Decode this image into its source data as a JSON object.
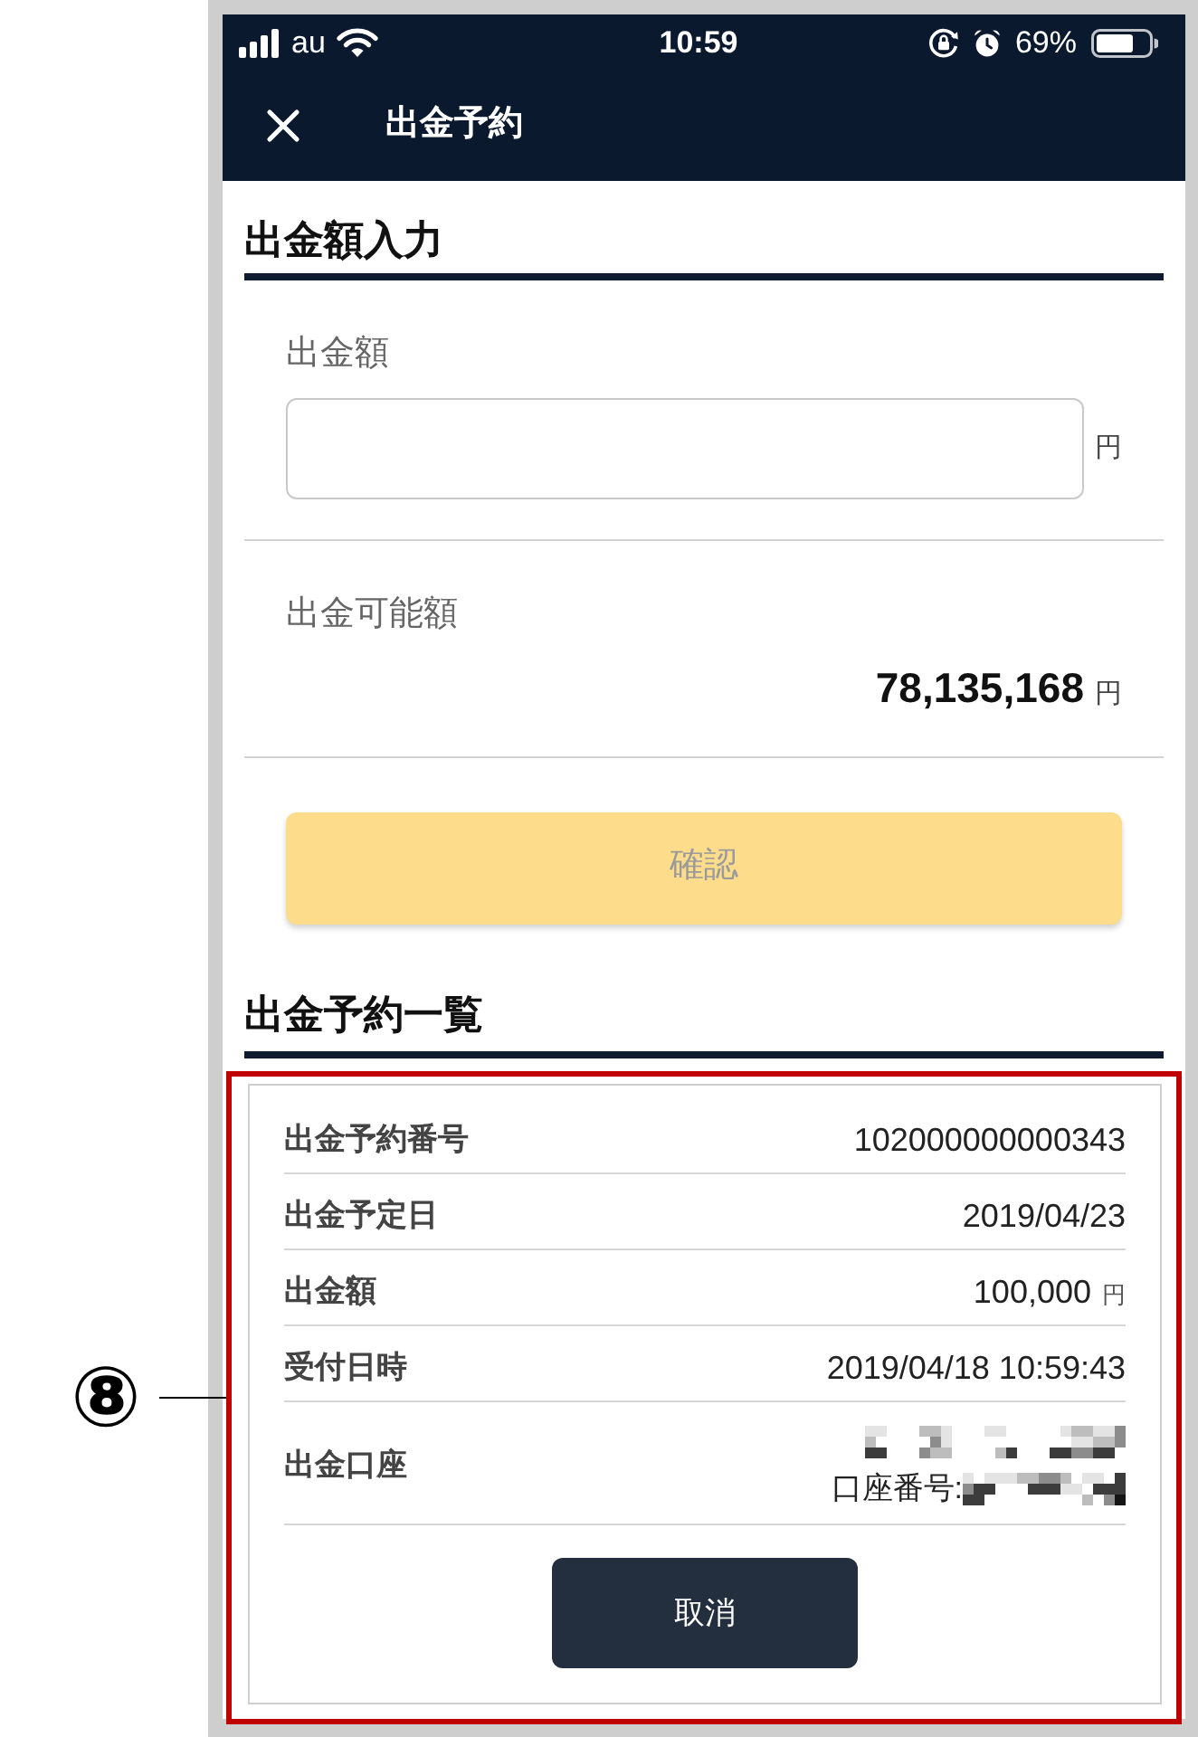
{
  "callout": {
    "number": "⑧"
  },
  "status_bar": {
    "carrier": "au",
    "time": "10:59",
    "battery_percent": "69%"
  },
  "header": {
    "title": "出金予約"
  },
  "amount_section": {
    "heading": "出金額入力",
    "amount_field": {
      "label": "出金額",
      "unit": "円"
    },
    "available": {
      "label": "出金可能額",
      "value": "78,135,168",
      "unit": "円"
    },
    "confirm_button": {
      "label": "確認",
      "disabled": true
    }
  },
  "reservation_list": {
    "heading": "出金予約一覧",
    "rows": [
      {
        "kind": "text",
        "label": "出金予約番号",
        "value": "102000000000343"
      },
      {
        "kind": "text",
        "label": "出金予定日",
        "value": "2019/04/23"
      },
      {
        "kind": "amount",
        "label": "出金額",
        "value": "100,000",
        "unit": "円"
      },
      {
        "kind": "text",
        "label": "受付日時",
        "value": "2019/04/18 10:59:43"
      },
      {
        "kind": "account",
        "label": "出金口座",
        "account_number_label": "口座番号:"
      }
    ],
    "cancel_button": {
      "label": "取消"
    }
  }
}
